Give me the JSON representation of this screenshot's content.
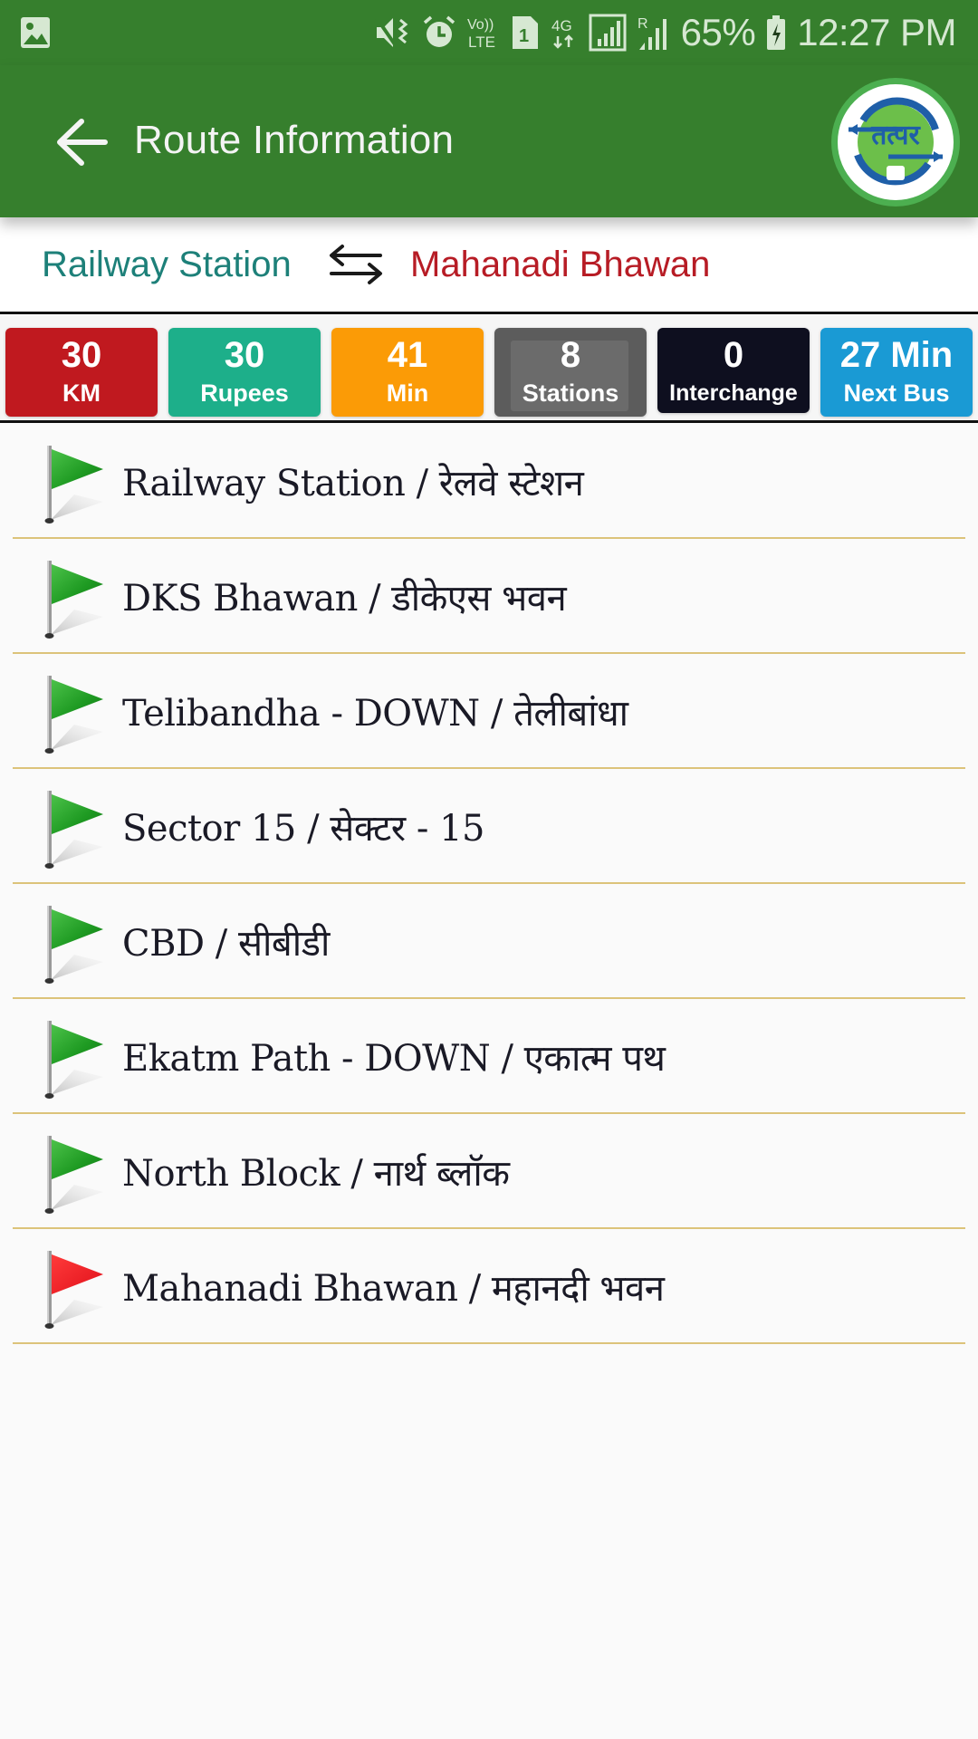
{
  "status_bar": {
    "battery_percent": "65%",
    "time": "12:27 PM",
    "network": "4G",
    "volte": "Vo)) LTE",
    "sim": "1",
    "icons": [
      "gallery-notification-icon",
      "vibrate-mute-icon",
      "alarm-icon",
      "volte-icon",
      "sim-1-icon",
      "data-4g-icon",
      "signal-icon",
      "roaming-signal-icon",
      "battery-charging-icon"
    ]
  },
  "header": {
    "title": "Route Information",
    "back_icon": "arrow-left-icon",
    "logo_text": "तत्पर"
  },
  "route": {
    "from": "Railway Station",
    "to": "Mahanadi Bhawan",
    "swap_icon": "swap-arrows-icon",
    "colors": {
      "from": "#1d8079",
      "to": "#b71c25"
    }
  },
  "stats": [
    {
      "value": "30",
      "label": "KM",
      "color": "#c0191f"
    },
    {
      "value": "30",
      "label": "Rupees",
      "color": "#1daf8a"
    },
    {
      "value": "41",
      "label": "Min",
      "color": "#fb9b06"
    },
    {
      "value": "8",
      "label": "Stations",
      "color": "#5c5c5c"
    },
    {
      "value": "0",
      "label": "Interchange",
      "color": "#0e0f1f"
    },
    {
      "value": "27 Min",
      "label": "Next Bus",
      "color": "#1a9ad4"
    }
  ],
  "stops": [
    {
      "name": "Railway Station / रेलवे स्टेशन",
      "flag": "green"
    },
    {
      "name": "DKS Bhawan / डीकेएस भवन",
      "flag": "green"
    },
    {
      "name": "Telibandha - DOWN / तेलीबांधा",
      "flag": "green"
    },
    {
      "name": "Sector 15 / सेक्टर - 15",
      "flag": "green"
    },
    {
      "name": "CBD / सीबीडी",
      "flag": "green"
    },
    {
      "name": "Ekatm Path - DOWN / एकात्म पथ",
      "flag": "green"
    },
    {
      "name": "North Block / नार्थ ब्लॉक",
      "flag": "green"
    },
    {
      "name": "Mahanadi Bhawan / महानदी भवन",
      "flag": "red"
    }
  ],
  "colors": {
    "appbar": "#367f2d",
    "divider": "#dcc37a",
    "flag_green": "#22a12a",
    "flag_red": "#f01b22"
  }
}
